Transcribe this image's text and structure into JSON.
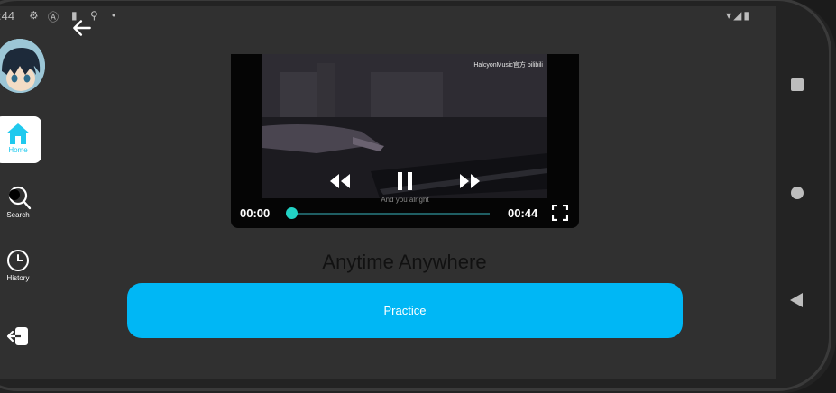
{
  "status_bar": {
    "time": ":44"
  },
  "nav": {
    "items": [
      {
        "label": "Home"
      },
      {
        "label": "Search"
      },
      {
        "label": "History"
      }
    ]
  },
  "video": {
    "watermark": "HalcyonMusic官方 bilibili",
    "subtitle": "And you alright",
    "current_time": "00:00",
    "duration": "00:44",
    "progress_fraction": 0.0
  },
  "content": {
    "title": "Anytime Anywhere",
    "practice_label": "Practice"
  },
  "colors": {
    "accent": "#00b7f5",
    "seek": "#22d3c5",
    "nav_active": "#1fc9ee"
  }
}
